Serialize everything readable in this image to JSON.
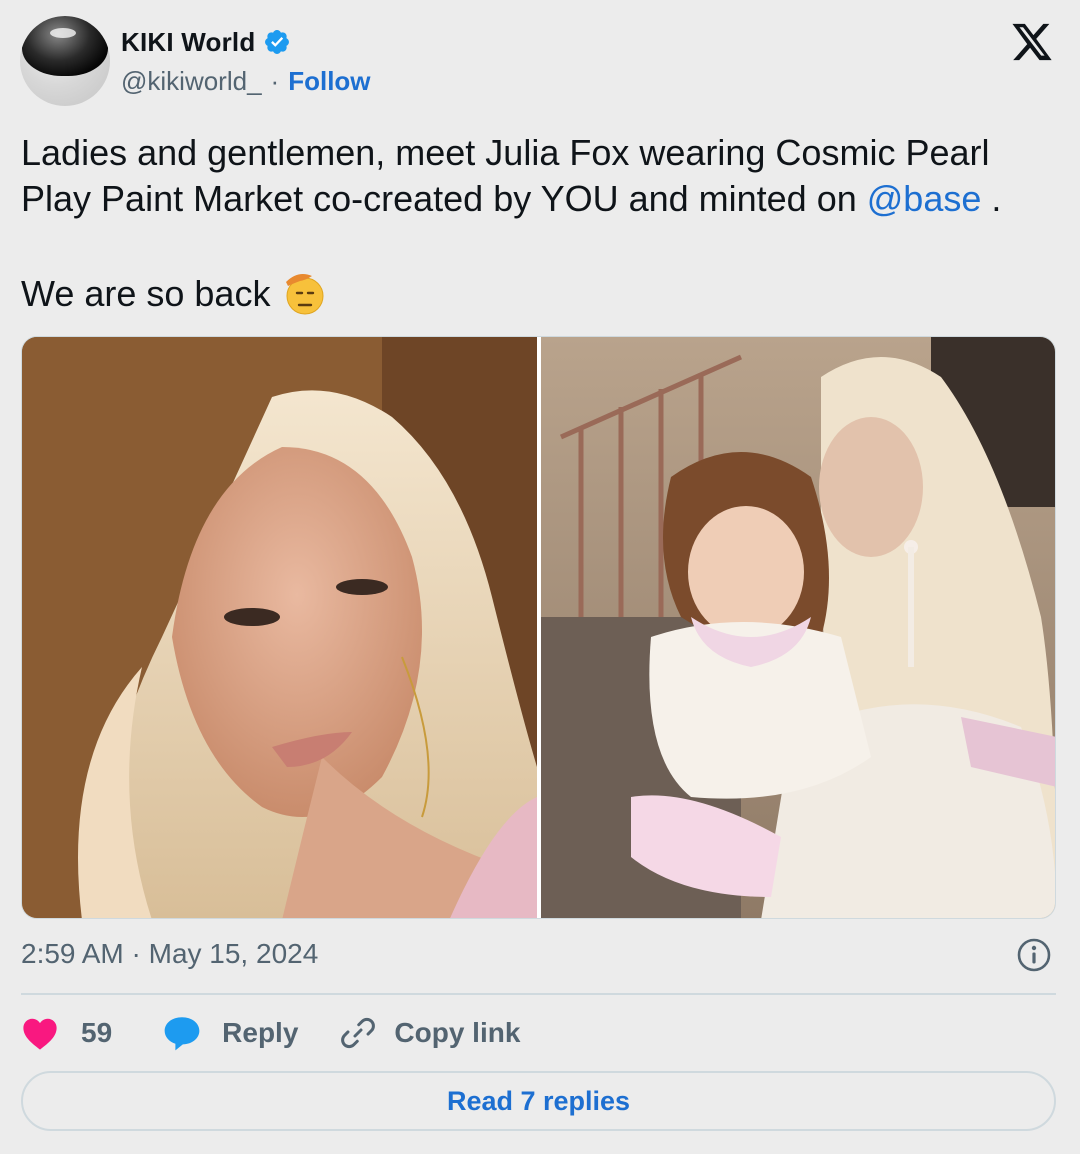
{
  "author": {
    "display_name": "KIKI World",
    "handle": "@kikiworld_",
    "separator": "·",
    "follow_label": "Follow",
    "verified": true
  },
  "tweet": {
    "line1": "Ladies and gentlemen, meet Julia Fox wearing Cosmic Pearl",
    "line2_before": "Play Paint Market co-created by YOU and minted on ",
    "mention": "@base",
    "line2_after": " .",
    "line3": "We are so back",
    "emoji": "saluting-face-icon"
  },
  "media": {
    "images": [
      "portrait-photo-left",
      "portrait-photo-right"
    ]
  },
  "meta": {
    "timestamp": "2:59 AM · May 15, 2024"
  },
  "actions": {
    "like_count": "59",
    "reply_label": "Reply",
    "copy_label": "Copy link"
  },
  "footer": {
    "read_replies_label": "Read 7 replies"
  },
  "colors": {
    "link": "#1d6fd1",
    "verified": "#1d9bf0",
    "like": "#f91880",
    "reply": "#1d9bf0",
    "muted": "#536471",
    "background": "#ececec"
  }
}
